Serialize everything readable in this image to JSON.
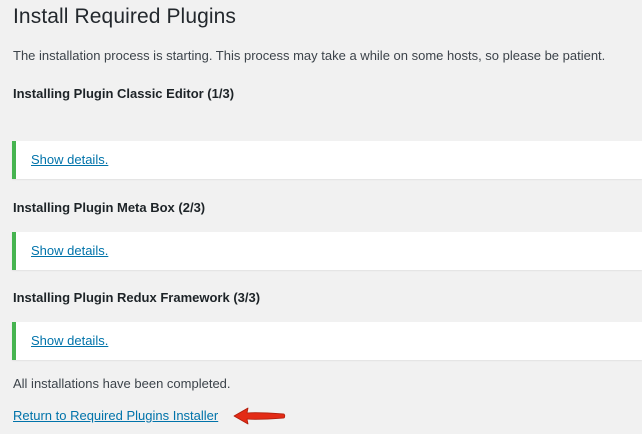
{
  "page": {
    "title": "Install Required Plugins",
    "intro": "The installation process is starting. This process may take a while on some hosts, so please be patient."
  },
  "steps": [
    {
      "heading": "Installing Plugin Classic Editor (1/3)",
      "details_link": "Show details."
    },
    {
      "heading": "Installing Plugin Meta Box (2/3)",
      "details_link": "Show details."
    },
    {
      "heading": "Installing Plugin Redux Framework (3/3)",
      "details_link": "Show details."
    }
  ],
  "footer": {
    "complete_message": "All installations have been completed.",
    "return_link": "Return to Required Plugins Installer"
  },
  "annotation": {
    "arrow_icon": "red-arrow-left-icon",
    "arrow_color": "#e32b16"
  },
  "colors": {
    "background": "#f1f1f1",
    "link": "#0073aa",
    "success_border": "#46b450"
  }
}
